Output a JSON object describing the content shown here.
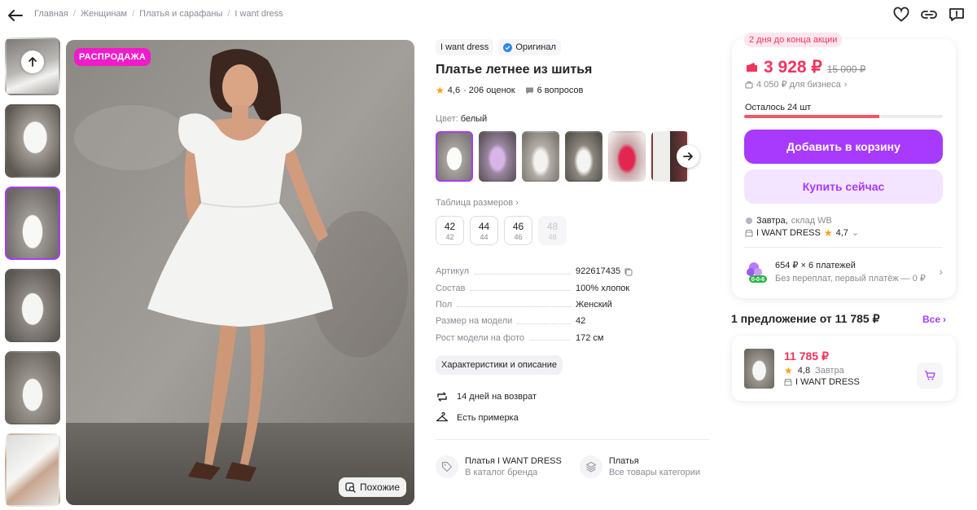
{
  "breadcrumbs": [
    "Главная",
    "Женщинам",
    "Платья и сарафаны",
    "I want dress"
  ],
  "gallery": {
    "sale_badge": "РАСПРОДАЖА",
    "similar_label": "Похожие"
  },
  "product": {
    "brand": "I want dress",
    "original_label": "Оригинал",
    "title": "Платье летнее из шитья",
    "rating": "4,6",
    "reviews": "· 206 оценок",
    "questions": "6 вопросов",
    "color_label": "Цвет:",
    "color_value": "белый",
    "size_table_label": "Таблица размеров",
    "sizes": [
      {
        "ru": "42",
        "eu": "42",
        "available": true
      },
      {
        "ru": "44",
        "eu": "44",
        "available": true
      },
      {
        "ru": "46",
        "eu": "46",
        "available": true
      },
      {
        "ru": "48",
        "eu": "48",
        "available": false
      }
    ],
    "specs": [
      {
        "key": "Артикул",
        "value": "922617435"
      },
      {
        "key": "Состав",
        "value": "100% хлопок"
      },
      {
        "key": "Пол",
        "value": "Женский"
      },
      {
        "key": "Размер на модели",
        "value": "42"
      },
      {
        "key": "Рост модели на фото",
        "value": "172 см"
      }
    ],
    "chars_button": "Характеристики и описание",
    "features": [
      "14 дней на возврат",
      "Есть примерка"
    ],
    "links": [
      {
        "title": "Платья I WANT DRESS",
        "sub": "В каталог бренда"
      },
      {
        "title": "Платья",
        "sub": "Все товары категории"
      }
    ]
  },
  "buy": {
    "promo": "2 дня до конца акции",
    "price": "3 928 ₽",
    "old_price": "15 000 ₽",
    "business_price": "4 050 ₽ для бизнеса",
    "stock_left": "Осталось 24 шт",
    "stock_fraction": 0.68,
    "add_to_cart": "Добавить в корзину",
    "buy_now": "Купить сейчас",
    "delivery_when": "Завтра,",
    "delivery_where": "склад WB",
    "seller": "I WANT DRESS",
    "seller_rating": "4,7",
    "installment_title": "654 ₽ × 6 платежей",
    "installment_sub": "Без переплат, первый платёж — 0 ₽",
    "installment_badge": "0-0-6"
  },
  "offers": {
    "title": "1 предложение от 11 785 ₽",
    "all_label": "Все",
    "item": {
      "price": "11 785 ₽",
      "rating": "4,8",
      "delivery": "Завтра",
      "seller": "I WANT DRESS"
    }
  },
  "colors": {
    "accent": "#a73afd",
    "price_red": "#f2335c",
    "sale_pink": "#f01bc9"
  }
}
